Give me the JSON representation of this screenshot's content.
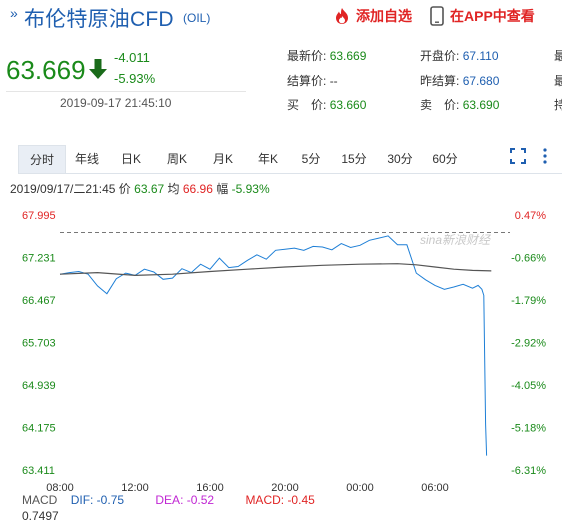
{
  "header": {
    "arrow": "»",
    "title": "布伦特原油CFD",
    "code": "(OIL)",
    "watch_label": "添加自选",
    "app_label": "在APP中查看"
  },
  "quote": {
    "price": "63.669",
    "change": "-4.011",
    "change_pct": "-5.93%",
    "time": "2019-09-17 21:45:10",
    "fields": [
      {
        "label": "最新价:",
        "value": "63.669"
      },
      {
        "label": "开盘价:",
        "value": "67.110"
      },
      {
        "label": "结算价:",
        "value": "--"
      },
      {
        "label": "昨结算:",
        "value": "67.680"
      },
      {
        "label": "买　价:",
        "value": "63.660"
      },
      {
        "label": "卖　价:",
        "value": "63.690"
      }
    ],
    "cut_chars": [
      "最",
      "最",
      "持"
    ]
  },
  "tabs": [
    "分时",
    "年线",
    "日K",
    "周K",
    "月K",
    "年K",
    "5分",
    "15分",
    "30分",
    "60分"
  ],
  "status": {
    "datetime": "2019/09/17/二21:45",
    "price_label": "价",
    "price": "63.67",
    "avg_label": "均",
    "avg": "66.96",
    "amp_label": "幅",
    "amp": "-5.93%"
  },
  "chart_data": {
    "type": "line",
    "y_ticks": [
      "67.995",
      "67.231",
      "66.467",
      "65.703",
      "64.939",
      "64.175",
      "63.411"
    ],
    "y_pct_ticks": [
      "0.47%",
      "-0.66%",
      "-1.79%",
      "-2.92%",
      "-4.05%",
      "-5.18%",
      "-6.31%"
    ],
    "x_ticks": [
      "08:00",
      "12:00",
      "16:00",
      "20:00",
      "00:00",
      "06:00"
    ],
    "ylim": [
      63.411,
      67.995
    ],
    "prev_settle": 67.68,
    "watermark": "sina新浪财经",
    "series": [
      {
        "x": [
          0,
          0.5,
          1,
          1.5,
          2,
          2.5,
          3,
          3.5,
          4,
          4.5,
          5,
          5.5,
          6,
          6.5,
          7,
          7.5,
          8,
          8.5,
          9,
          9.5,
          10,
          10.5,
          11,
          11.5,
          12,
          12.5,
          13,
          13.5,
          14,
          14.5,
          15,
          15.5,
          16,
          16.5,
          17,
          17.5,
          18,
          18.5,
          19,
          19.5,
          20,
          20.5,
          21,
          21.5,
          22,
          22.3,
          22.5,
          22.6,
          22.7,
          22.75
        ],
        "values": [
          66.93,
          66.96,
          66.98,
          66.93,
          66.72,
          66.58,
          66.85,
          66.95,
          66.91,
          67.02,
          66.97,
          66.84,
          66.86,
          67.03,
          66.96,
          67.11,
          67.02,
          67.22,
          67.05,
          67.07,
          67.18,
          67.28,
          67.2,
          67.36,
          67.38,
          67.4,
          67.36,
          67.43,
          67.42,
          67.37,
          67.48,
          67.41,
          67.45,
          67.54,
          67.58,
          67.62,
          67.46,
          67.46,
          66.95,
          66.83,
          66.73,
          66.66,
          66.7,
          66.75,
          66.68,
          66.73,
          66.66,
          66.55,
          64.23,
          63.67
        ]
      },
      {
        "x": [
          0,
          2,
          4,
          6,
          8,
          10,
          12,
          14,
          16,
          18,
          19,
          20,
          21,
          22,
          23
        ],
        "values": [
          66.93,
          66.96,
          66.91,
          66.93,
          66.98,
          67.02,
          67.06,
          67.09,
          67.11,
          67.12,
          67.1,
          67.06,
          67.02,
          67.0,
          66.99
        ]
      }
    ]
  },
  "macd": {
    "label": "MACD",
    "dif": "DIF: -0.75",
    "dea": "DEA: -0.52",
    "macd": "MACD: -0.45",
    "value": "0.7497"
  }
}
